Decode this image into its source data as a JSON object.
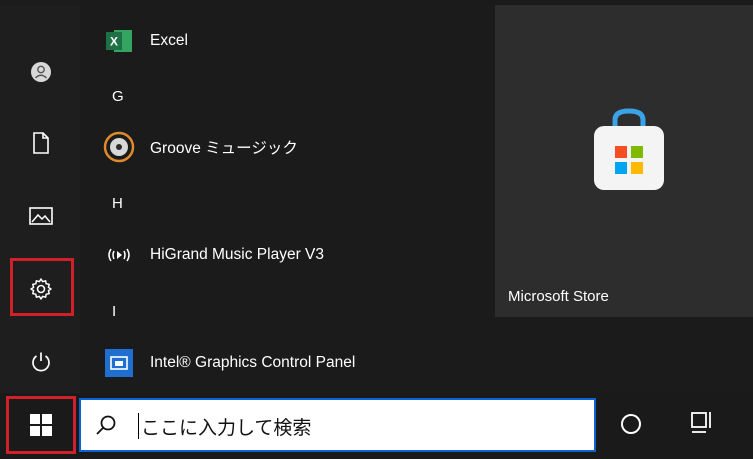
{
  "apps": [
    {
      "label": "Excel"
    },
    {
      "label": "Groove ミュージック"
    },
    {
      "label": "HiGrand Music Player V3"
    },
    {
      "label": "Intel® Graphics Control Panel"
    }
  ],
  "letters": [
    "G",
    "H",
    "I"
  ],
  "tile": {
    "label": "Microsoft Store"
  },
  "search": {
    "placeholder": "ここに入力して検索"
  },
  "sidebar": [
    "user-icon",
    "document-icon",
    "pictures-icon",
    "settings-icon",
    "power-icon"
  ],
  "colors": {
    "highlight": "#d0202a",
    "search_border": "#0b63d6",
    "excel_green": "#1e7145"
  }
}
